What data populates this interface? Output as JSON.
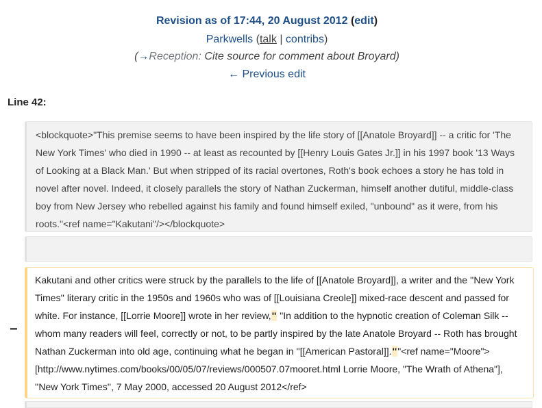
{
  "header": {
    "revision_title": "Revision as of 17:44, 20 August 2012",
    "edit_label": "edit",
    "user_name": "Parkwells",
    "talk_label": "talk",
    "separator": "|",
    "contribs_label": "contribs",
    "summary_arrow": "→",
    "summary_section": "Reception:",
    "summary_text": "Cite source for comment about Broyard",
    "previous_edit": "← Previous edit"
  },
  "diff": {
    "line_label": "Line 42:",
    "context_text": "<blockquote>\"This premise seems to have been inspired by the life story of [[Anatole Broyard]] -- a critic for 'The New York Times' who died in 1990 -- at least as recounted by [[Henry Louis Gates Jr.]] in his 1997 book '13 Ways of Looking at a Black Man.' But when stripped of its racial overtones, Roth's book echoes a story he has told in novel after novel. Indeed, it closely parallels the story of Nathan Zuckerman, himself another dutiful, middle-class boy from New Jersey who rebelled against his family and found himself exiled, \"unbound\" as it were, from his roots.\"<ref name=\"Kakutani\"/></blockquote>",
    "marker": "−",
    "deleted_part1": "Kakutani and other critics were struck by the parallels to the life of [[Anatole Broyard]], a writer and the ''New York Times'' literary critic in the 1950s and 1960s who was of [[Louisiana Creole]] mixed-race descent and passed for white. For instance, [[Lorrie Moore]] wrote in her review,",
    "deleted_hl1": "''",
    "deleted_part2": " \"In addition to the hypnotic creation of Coleman Silk -- whom many readers will feel, correctly or not, to be partly inspired by the late Anatole Broyard -- Roth has brought Nathan Zuckerman into old age, continuing what he began in ''[[American Pastoral]].",
    "deleted_hl2": "''",
    "deleted_part3": "\"<ref name=\"Moore\">[http://www.nytimes.com/books/00/05/07/reviews/000507.07mooret.html Lorrie Moore, \"The Wrath of Athena\"], ''New York Times'', 7 May 2000, accessed 20 August 2012</ref>"
  }
}
